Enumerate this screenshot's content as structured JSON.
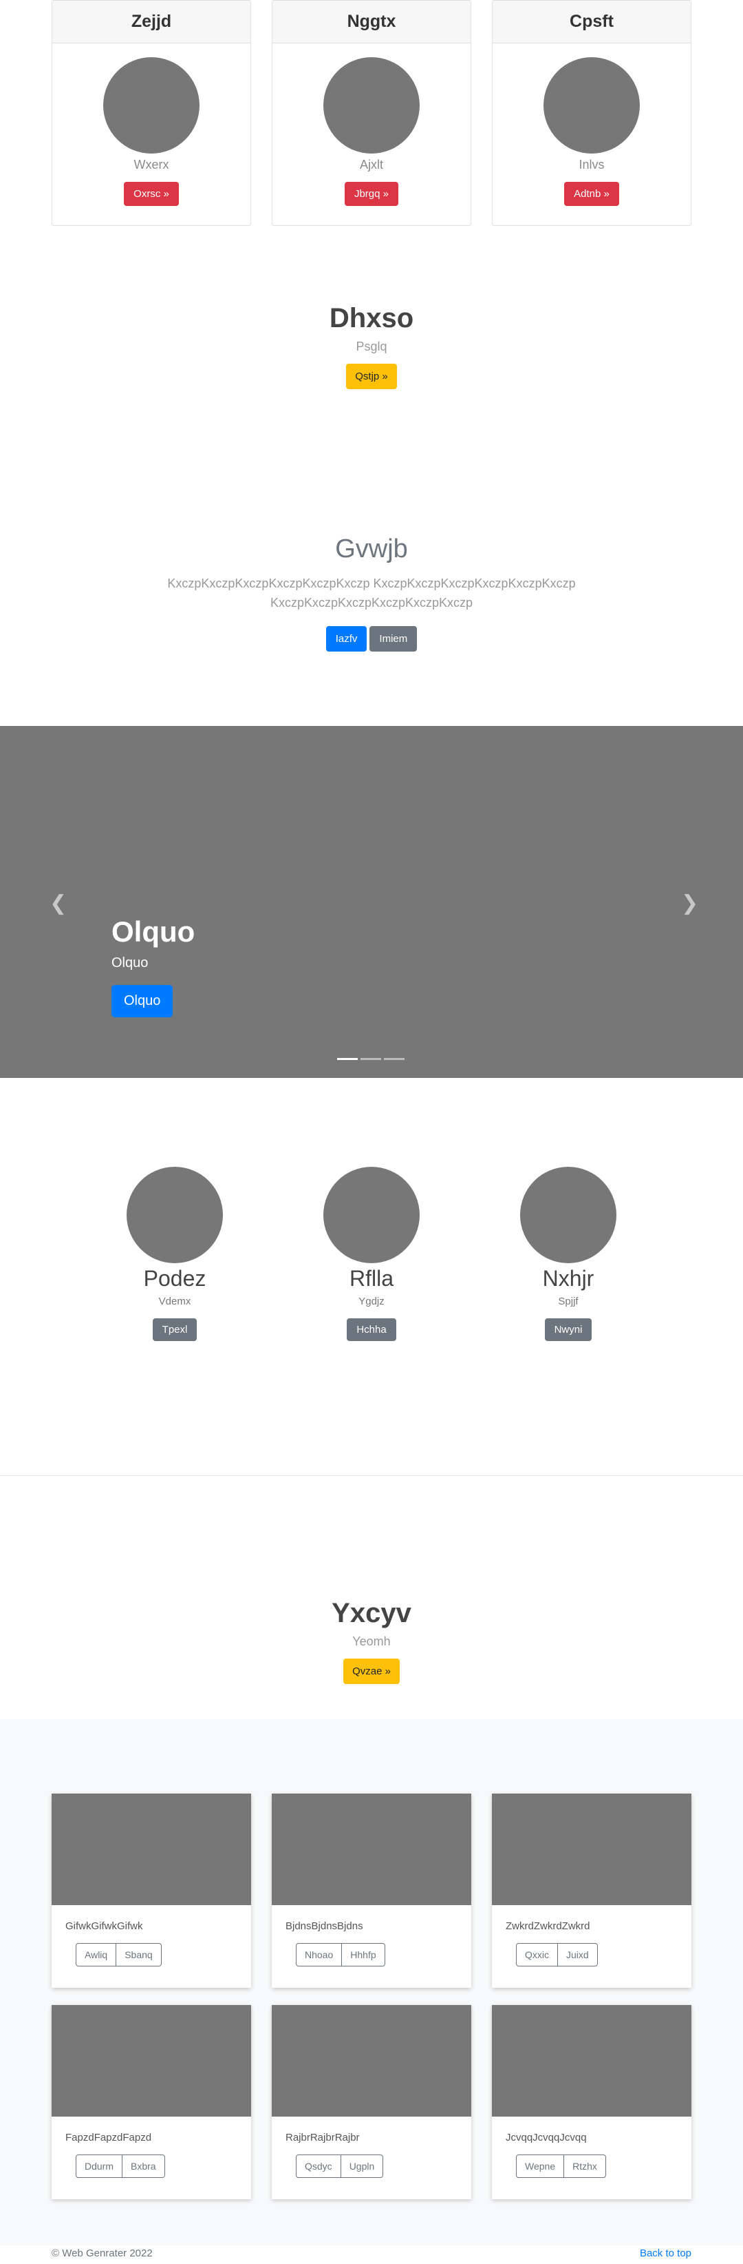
{
  "pricing_cards": [
    {
      "title": "Zejjd",
      "subtitle": "Wxerx",
      "button": "Oxrsc »"
    },
    {
      "title": "Nggtx",
      "subtitle": "Ajxlt",
      "button": "Jbrgq »"
    },
    {
      "title": "Cpsft",
      "subtitle": "Inlvs",
      "button": "Adtnb »"
    }
  ],
  "hero1": {
    "title": "Dhxso",
    "subtitle": "Psglq",
    "button": "Qstjp »"
  },
  "jumbo": {
    "title": "Gvwjb",
    "lead": "KxczpKxczpKxczpKxczpKxczpKxczp KxczpKxczpKxczpKxczpKxczpKxczp KxczpKxczpKxczpKxczpKxczpKxczp",
    "primary_button": "Iazfv",
    "secondary_button": "Imiem"
  },
  "carousel": {
    "title": "Olquo",
    "text": "Olquo",
    "button": "Olquo",
    "prev_icon": "chevron-left-icon",
    "next_icon": "chevron-right-icon",
    "indicator_count": 3,
    "active_indicator": 0
  },
  "marketing": [
    {
      "name": "Podez",
      "subtitle": "Vdemx",
      "button": "Tpexl"
    },
    {
      "name": "Rflla",
      "subtitle": "Ygdjz",
      "button": "Hchha"
    },
    {
      "name": "Nxhjr",
      "subtitle": "Spjjf",
      "button": "Nwyni"
    }
  ],
  "hero2": {
    "title": "Yxcyv",
    "subtitle": "Yeomh",
    "button": "Qvzae »"
  },
  "album": [
    {
      "text": "GifwkGifwkGifwk",
      "btn1": "Awliq",
      "btn2": "Sbanq"
    },
    {
      "text": "BjdnsBjdnsBjdns",
      "btn1": "Nhoao",
      "btn2": "Hhhfp"
    },
    {
      "text": "ZwkrdZwkrdZwkrd",
      "btn1": "Qxxic",
      "btn2": "Juixd"
    },
    {
      "text": "FapzdFapzdFapzd",
      "btn1": "Ddurm",
      "btn2": "Bxbra"
    },
    {
      "text": "RajbrRajbrRajbr",
      "btn1": "Qsdyc",
      "btn2": "Ugpln"
    },
    {
      "text": "JcvqqJcvqqJcvqq",
      "btn1": "Wepne",
      "btn2": "Rtzhx"
    }
  ],
  "footer": {
    "copyright": "© Web Genrater 2022",
    "back_to_top": "Back to top"
  },
  "colors": {
    "primary": "#007bff",
    "danger": "#dc3545",
    "warning": "#ffc107",
    "secondary": "#6c757d",
    "placeholder": "#777777"
  }
}
